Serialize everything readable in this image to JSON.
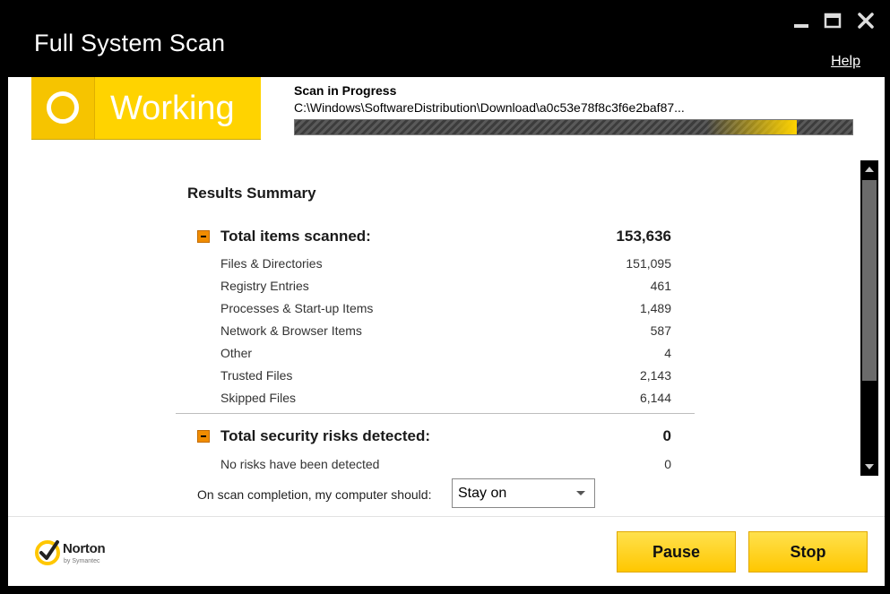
{
  "window": {
    "title": "Full System Scan",
    "help_label": "Help"
  },
  "status": {
    "text": "Working",
    "scan_label": "Scan in Progress",
    "scan_path": "C:\\Windows\\SoftwareDistribution\\Download\\a0c53e78f8c3f6e2baf87...",
    "progress_fraction": 0.9
  },
  "summary": {
    "title": "Results Summary",
    "scanned": {
      "label": "Total items scanned:",
      "value": "153,636",
      "rows": [
        {
          "label": "Files & Directories",
          "value": "151,095"
        },
        {
          "label": "Registry Entries",
          "value": "461"
        },
        {
          "label": "Processes & Start-up Items",
          "value": "1,489"
        },
        {
          "label": "Network & Browser Items",
          "value": "587"
        },
        {
          "label": "Other",
          "value": "4"
        },
        {
          "label": "Trusted Files",
          "value": "2,143"
        },
        {
          "label": "Skipped Files",
          "value": "6,144"
        }
      ]
    },
    "risks": {
      "label": "Total security risks detected:",
      "value": "0",
      "rows": [
        {
          "label": "No risks have been detected",
          "value": "0"
        }
      ]
    }
  },
  "completion": {
    "label": "On scan completion, my computer should:",
    "selected": "Stay on"
  },
  "footer": {
    "brand": "Norton",
    "brand_sub": "by Symantec",
    "pause_label": "Pause",
    "stop_label": "Stop"
  },
  "colors": {
    "accent": "#ffd300",
    "collapse": "#f08c00"
  }
}
